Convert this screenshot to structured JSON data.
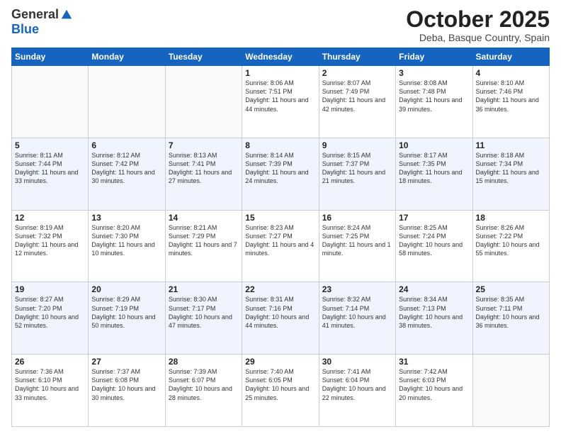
{
  "header": {
    "logo_general": "General",
    "logo_blue": "Blue",
    "month_title": "October 2025",
    "location": "Deba, Basque Country, Spain"
  },
  "weekdays": [
    "Sunday",
    "Monday",
    "Tuesday",
    "Wednesday",
    "Thursday",
    "Friday",
    "Saturday"
  ],
  "weeks": [
    [
      {
        "day": "",
        "sunrise": "",
        "sunset": "",
        "daylight": ""
      },
      {
        "day": "",
        "sunrise": "",
        "sunset": "",
        "daylight": ""
      },
      {
        "day": "",
        "sunrise": "",
        "sunset": "",
        "daylight": ""
      },
      {
        "day": "1",
        "sunrise": "Sunrise: 8:06 AM",
        "sunset": "Sunset: 7:51 PM",
        "daylight": "Daylight: 11 hours and 44 minutes."
      },
      {
        "day": "2",
        "sunrise": "Sunrise: 8:07 AM",
        "sunset": "Sunset: 7:49 PM",
        "daylight": "Daylight: 11 hours and 42 minutes."
      },
      {
        "day": "3",
        "sunrise": "Sunrise: 8:08 AM",
        "sunset": "Sunset: 7:48 PM",
        "daylight": "Daylight: 11 hours and 39 minutes."
      },
      {
        "day": "4",
        "sunrise": "Sunrise: 8:10 AM",
        "sunset": "Sunset: 7:46 PM",
        "daylight": "Daylight: 11 hours and 36 minutes."
      }
    ],
    [
      {
        "day": "5",
        "sunrise": "Sunrise: 8:11 AM",
        "sunset": "Sunset: 7:44 PM",
        "daylight": "Daylight: 11 hours and 33 minutes."
      },
      {
        "day": "6",
        "sunrise": "Sunrise: 8:12 AM",
        "sunset": "Sunset: 7:42 PM",
        "daylight": "Daylight: 11 hours and 30 minutes."
      },
      {
        "day": "7",
        "sunrise": "Sunrise: 8:13 AM",
        "sunset": "Sunset: 7:41 PM",
        "daylight": "Daylight: 11 hours and 27 minutes."
      },
      {
        "day": "8",
        "sunrise": "Sunrise: 8:14 AM",
        "sunset": "Sunset: 7:39 PM",
        "daylight": "Daylight: 11 hours and 24 minutes."
      },
      {
        "day": "9",
        "sunrise": "Sunrise: 8:15 AM",
        "sunset": "Sunset: 7:37 PM",
        "daylight": "Daylight: 11 hours and 21 minutes."
      },
      {
        "day": "10",
        "sunrise": "Sunrise: 8:17 AM",
        "sunset": "Sunset: 7:35 PM",
        "daylight": "Daylight: 11 hours and 18 minutes."
      },
      {
        "day": "11",
        "sunrise": "Sunrise: 8:18 AM",
        "sunset": "Sunset: 7:34 PM",
        "daylight": "Daylight: 11 hours and 15 minutes."
      }
    ],
    [
      {
        "day": "12",
        "sunrise": "Sunrise: 8:19 AM",
        "sunset": "Sunset: 7:32 PM",
        "daylight": "Daylight: 11 hours and 12 minutes."
      },
      {
        "day": "13",
        "sunrise": "Sunrise: 8:20 AM",
        "sunset": "Sunset: 7:30 PM",
        "daylight": "Daylight: 11 hours and 10 minutes."
      },
      {
        "day": "14",
        "sunrise": "Sunrise: 8:21 AM",
        "sunset": "Sunset: 7:29 PM",
        "daylight": "Daylight: 11 hours and 7 minutes."
      },
      {
        "day": "15",
        "sunrise": "Sunrise: 8:23 AM",
        "sunset": "Sunset: 7:27 PM",
        "daylight": "Daylight: 11 hours and 4 minutes."
      },
      {
        "day": "16",
        "sunrise": "Sunrise: 8:24 AM",
        "sunset": "Sunset: 7:25 PM",
        "daylight": "Daylight: 11 hours and 1 minute."
      },
      {
        "day": "17",
        "sunrise": "Sunrise: 8:25 AM",
        "sunset": "Sunset: 7:24 PM",
        "daylight": "Daylight: 10 hours and 58 minutes."
      },
      {
        "day": "18",
        "sunrise": "Sunrise: 8:26 AM",
        "sunset": "Sunset: 7:22 PM",
        "daylight": "Daylight: 10 hours and 55 minutes."
      }
    ],
    [
      {
        "day": "19",
        "sunrise": "Sunrise: 8:27 AM",
        "sunset": "Sunset: 7:20 PM",
        "daylight": "Daylight: 10 hours and 52 minutes."
      },
      {
        "day": "20",
        "sunrise": "Sunrise: 8:29 AM",
        "sunset": "Sunset: 7:19 PM",
        "daylight": "Daylight: 10 hours and 50 minutes."
      },
      {
        "day": "21",
        "sunrise": "Sunrise: 8:30 AM",
        "sunset": "Sunset: 7:17 PM",
        "daylight": "Daylight: 10 hours and 47 minutes."
      },
      {
        "day": "22",
        "sunrise": "Sunrise: 8:31 AM",
        "sunset": "Sunset: 7:16 PM",
        "daylight": "Daylight: 10 hours and 44 minutes."
      },
      {
        "day": "23",
        "sunrise": "Sunrise: 8:32 AM",
        "sunset": "Sunset: 7:14 PM",
        "daylight": "Daylight: 10 hours and 41 minutes."
      },
      {
        "day": "24",
        "sunrise": "Sunrise: 8:34 AM",
        "sunset": "Sunset: 7:13 PM",
        "daylight": "Daylight: 10 hours and 38 minutes."
      },
      {
        "day": "25",
        "sunrise": "Sunrise: 8:35 AM",
        "sunset": "Sunset: 7:11 PM",
        "daylight": "Daylight: 10 hours and 36 minutes."
      }
    ],
    [
      {
        "day": "26",
        "sunrise": "Sunrise: 7:36 AM",
        "sunset": "Sunset: 6:10 PM",
        "daylight": "Daylight: 10 hours and 33 minutes."
      },
      {
        "day": "27",
        "sunrise": "Sunrise: 7:37 AM",
        "sunset": "Sunset: 6:08 PM",
        "daylight": "Daylight: 10 hours and 30 minutes."
      },
      {
        "day": "28",
        "sunrise": "Sunrise: 7:39 AM",
        "sunset": "Sunset: 6:07 PM",
        "daylight": "Daylight: 10 hours and 28 minutes."
      },
      {
        "day": "29",
        "sunrise": "Sunrise: 7:40 AM",
        "sunset": "Sunset: 6:05 PM",
        "daylight": "Daylight: 10 hours and 25 minutes."
      },
      {
        "day": "30",
        "sunrise": "Sunrise: 7:41 AM",
        "sunset": "Sunset: 6:04 PM",
        "daylight": "Daylight: 10 hours and 22 minutes."
      },
      {
        "day": "31",
        "sunrise": "Sunrise: 7:42 AM",
        "sunset": "Sunset: 6:03 PM",
        "daylight": "Daylight: 10 hours and 20 minutes."
      },
      {
        "day": "",
        "sunrise": "",
        "sunset": "",
        "daylight": ""
      }
    ]
  ]
}
